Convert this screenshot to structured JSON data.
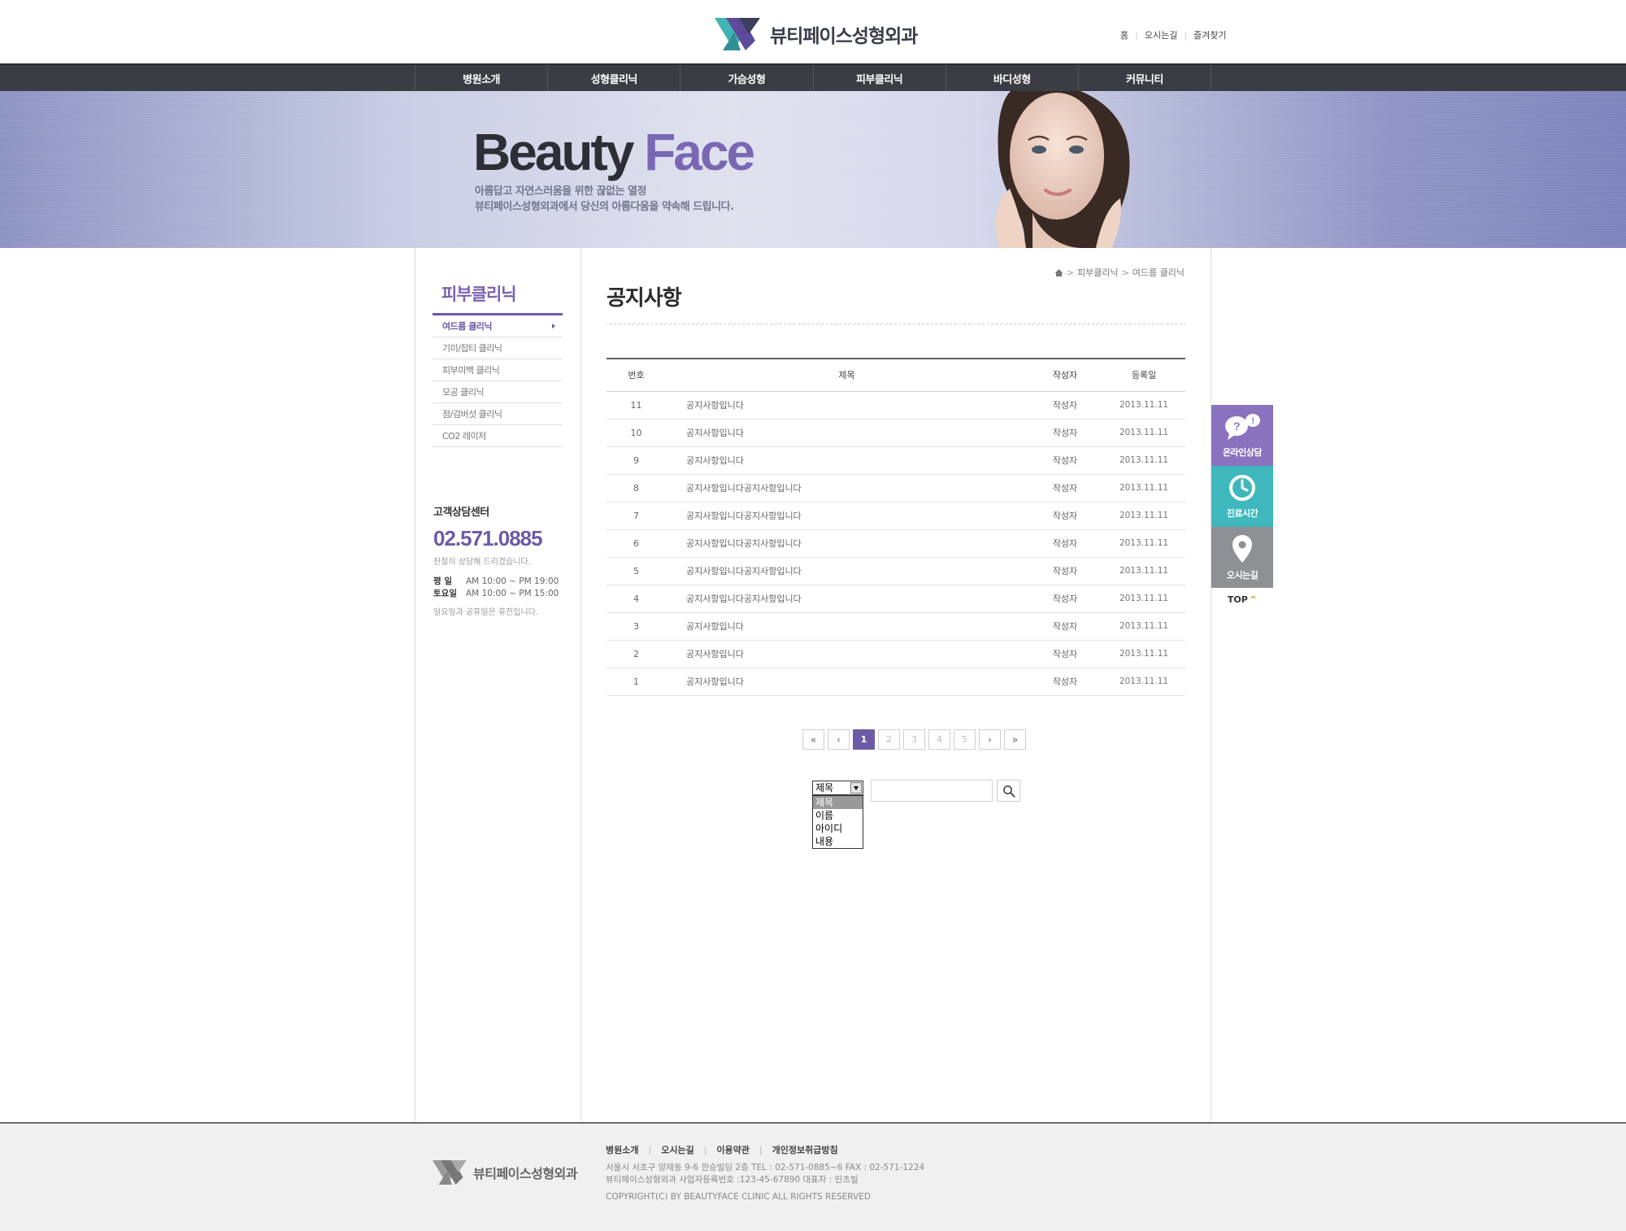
{
  "header": {
    "logo_text": "뷰티페이스성형외과",
    "util_links": [
      "홈",
      "오시는길",
      "즐겨찾기"
    ]
  },
  "gnb": [
    "병원소개",
    "성형클리닉",
    "가슴성형",
    "피부클리닉",
    "바디성형",
    "커뮤니티"
  ],
  "visual": {
    "title_part1": "Beauty",
    "title_part2": "Face",
    "copy_line1": "아름답고 자연스러움을 위한 끊없는 열정",
    "copy_line2": "뷰티페이스성형외과에서 당신의 아름다움을 약속해 드립니다."
  },
  "lnb": {
    "title": "피부클리닉",
    "items": [
      "여드름 클리닉",
      "기미/잡티 클리닉",
      "피부미백 클리닉",
      "모공 클리닉",
      "점/검버섯 클리닉",
      "CO2 레이저"
    ],
    "active_index": 0
  },
  "customer_center": {
    "title": "고객상담센터",
    "phone": "02.571.0885",
    "subtitle": "친절히 상담해 드리겠습니다.",
    "weekday_label": "평   일",
    "weekday_hours": "AM 10:00 ~ PM 19:00",
    "saturday_label": "토요일",
    "saturday_hours": "AM 10:00 ~ PM 15:00",
    "note": "일요일과 공휴일은 휴진입니다."
  },
  "breadcrumb": [
    "피부클리닉",
    "여드름 클리닉"
  ],
  "page_title": "공지사항",
  "board": {
    "columns": [
      "번호",
      "제목",
      "작성자",
      "등록일"
    ],
    "rows": [
      {
        "no": "11",
        "title": "공지사항입니다",
        "writer": "작성자",
        "date": "2013.11.11"
      },
      {
        "no": "10",
        "title": "공지사항입니다",
        "writer": "작성자",
        "date": "2013.11.11"
      },
      {
        "no": "9",
        "title": "공지사항입니다",
        "writer": "작성자",
        "date": "2013.11.11"
      },
      {
        "no": "8",
        "title": "공지사항입니다공지사항입니다",
        "writer": "작성자",
        "date": "2013.11.11"
      },
      {
        "no": "7",
        "title": "공지사항입니다공지사항입니다",
        "writer": "작성자",
        "date": "2013.11.11"
      },
      {
        "no": "6",
        "title": "공지사항입니다공지사항입니다",
        "writer": "작성자",
        "date": "2013.11.11"
      },
      {
        "no": "5",
        "title": "공지사항입니다공지사항입니다",
        "writer": "작성자",
        "date": "2013.11.11"
      },
      {
        "no": "4",
        "title": "공지사항입니다공지사항입니다",
        "writer": "작성자",
        "date": "2013.11.11"
      },
      {
        "no": "3",
        "title": "공지사항입니다",
        "writer": "작성자",
        "date": "2013.11.11"
      },
      {
        "no": "2",
        "title": "공지사항입니다",
        "writer": "작성자",
        "date": "2013.11.11"
      },
      {
        "no": "1",
        "title": "공지사항입니다",
        "writer": "작성자",
        "date": "2013.11.11"
      }
    ]
  },
  "pagination": {
    "first": "«",
    "prev": "‹",
    "pages": [
      "1",
      "2",
      "3",
      "4",
      "5"
    ],
    "current": "1",
    "next": "›",
    "last": "»"
  },
  "search": {
    "selected": "제목",
    "options": [
      "제목",
      "이름",
      "아이디",
      "내용"
    ],
    "query": ""
  },
  "quick_menu": {
    "consult": "온라인상담",
    "hours": "진료시간",
    "map": "오시는길",
    "top": "TOP"
  },
  "footer": {
    "logo_text": "뷰티페이스성형외과",
    "links": [
      "병원소개",
      "오시는길",
      "이용약관",
      "개인정보취급방침"
    ],
    "address": "서울시 서초구 양재동 9-6  한승빌딩 2층  TEL : 02-571-0885~6  FAX : 02-571-1224",
    "business": "뷰티페이스성형외과  사업자등록번호 :123-45-67890  대표자 : 인츠빌",
    "copyright": "COPYRIGHT(C) BY BEAUTYFACE CLINIC ALL RIGHTS RESERVED"
  },
  "colors": {
    "accent": "#6d5aa6",
    "gnb_bg": "#3b3d44",
    "consult": "#8b72bf",
    "hours": "#3fb8bd",
    "map": "#8f9094"
  }
}
